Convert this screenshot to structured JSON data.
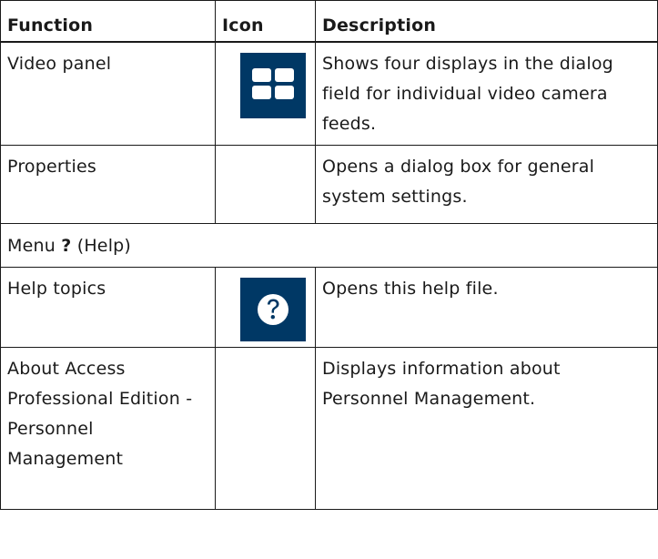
{
  "table": {
    "headers": {
      "function": "Function",
      "icon": "Icon",
      "description": "Description"
    },
    "rows": [
      {
        "function": "Video panel",
        "icon": "video-panel-grid-icon",
        "description": "Shows four displays in the dialog field for individual video camera feeds."
      },
      {
        "function": "Properties",
        "icon": "",
        "description": "Opens a dialog box for general system settings."
      },
      {
        "menu_prefix": "Menu",
        "menu_symbol": "?",
        "menu_suffix": "(Help)"
      },
      {
        "function": "Help topics",
        "icon": "help-question-icon",
        "description": "Opens this help file."
      },
      {
        "function": "About Access Professional Edition - Personnel Management",
        "icon": "",
        "description": "Displays information about Personnel Management."
      }
    ]
  },
  "colors": {
    "icon_background": "#003865",
    "icon_foreground": "#ffffff",
    "border": "#1a1a1a"
  }
}
